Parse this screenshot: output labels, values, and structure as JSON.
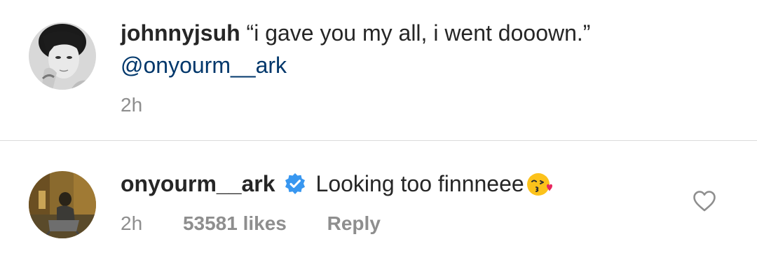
{
  "caption": {
    "username": "johnnyjsuh",
    "text": "“i gave you my all, i went dooown.”",
    "mention": "@onyourm__ark",
    "time": "2h",
    "avatar_icon": "profile-photo-grayscale-portrait"
  },
  "comment": {
    "username": "onyourm__ark",
    "verified_icon": "verified-badge-icon",
    "text": "Looking too finnneee",
    "emoji_icon": "kissing-face-with-heart-emoji",
    "time": "2h",
    "likes": "53581 likes",
    "reply_label": "Reply",
    "heart_icon": "heart-outline-icon",
    "avatar_icon": "profile-photo-warm-tones"
  },
  "colors": {
    "text": "#262626",
    "muted": "#8e8e8e",
    "mention": "#00376b",
    "verified": "#3897f0",
    "divider": "#dbdbdb"
  }
}
